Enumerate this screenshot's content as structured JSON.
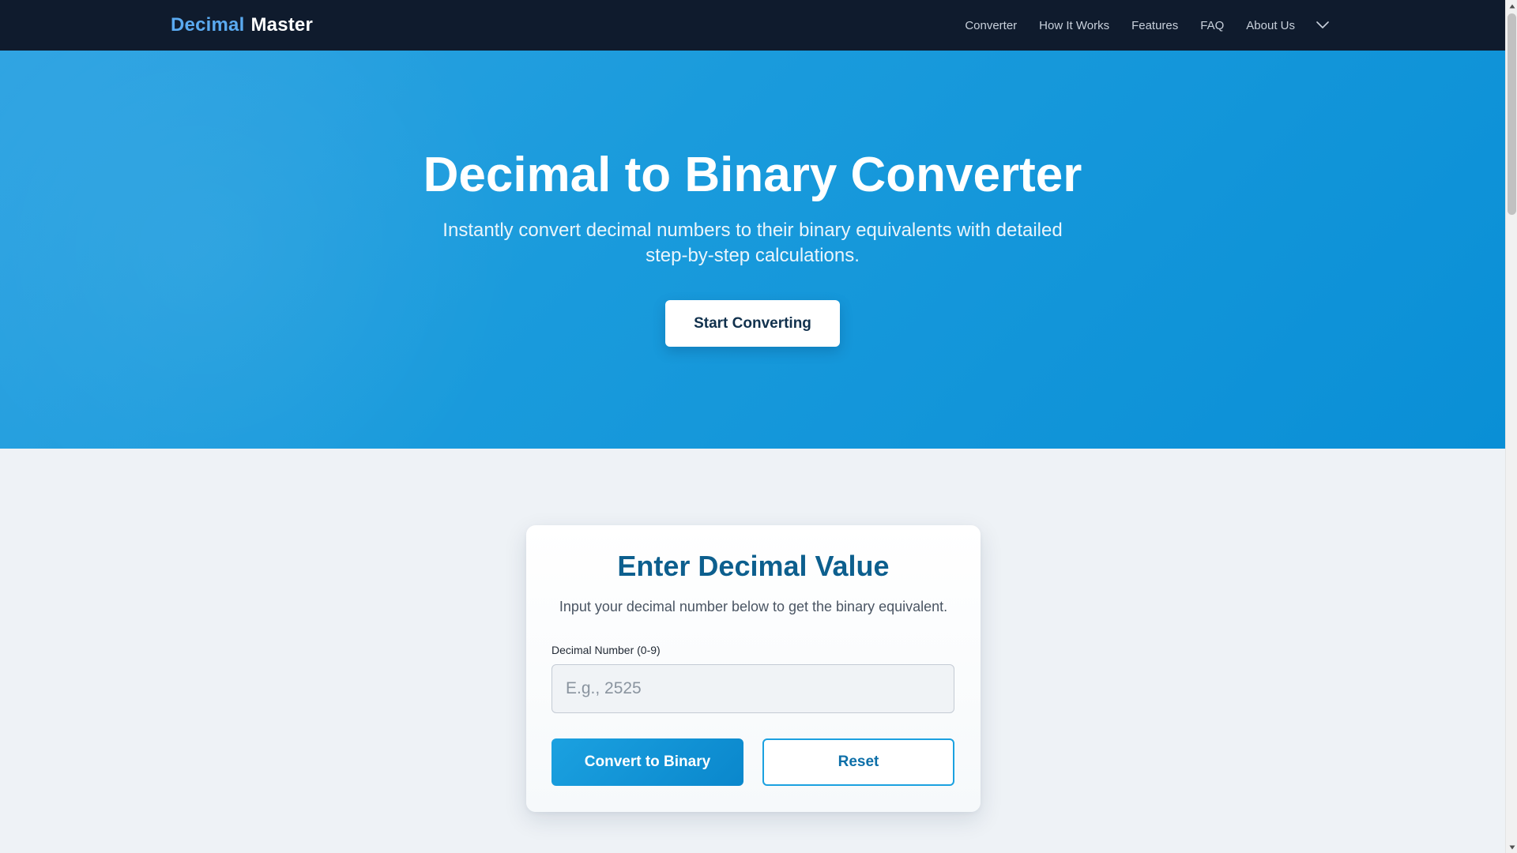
{
  "nav": {
    "brand_part1": "Decimal",
    "brand_part2": "Master",
    "links": [
      "Converter",
      "How It Works",
      "Features",
      "FAQ",
      "About Us"
    ],
    "more_icon": "chevron-down-icon"
  },
  "hero": {
    "title": "Decimal to Binary Converter",
    "subtitle": "Instantly convert decimal numbers to their binary equivalents with detailed step-by-step calculations.",
    "cta_label": "Start Converting"
  },
  "converter": {
    "title": "Enter Decimal Value",
    "description": "Input your decimal number below to get the binary equivalent.",
    "field_label": "Decimal Number (0-9)",
    "input_value": "",
    "input_placeholder": "E.g., 2525",
    "convert_label": "Convert to Binary",
    "reset_label": "Reset"
  },
  "colors": {
    "nav_bg": "#0f1b2d",
    "brand_accent": "#5aaaf0",
    "hero_start": "#2ea3e2",
    "hero_end": "#0a8fd6",
    "card_title": "#0d5f8e",
    "primary_button": "#1ba1e0"
  }
}
